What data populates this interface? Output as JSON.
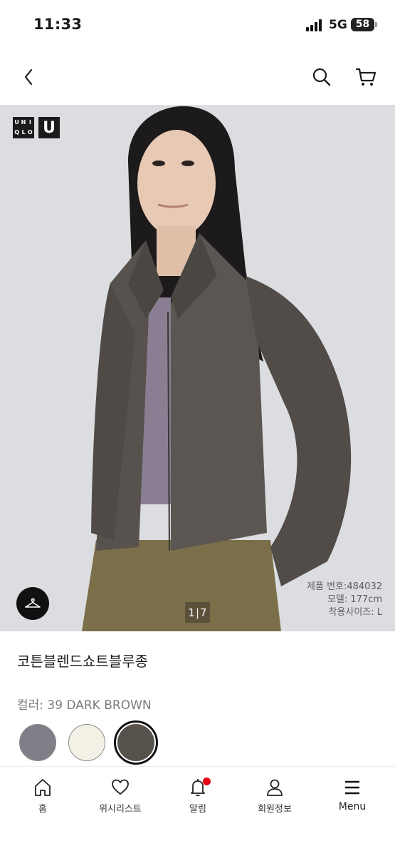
{
  "status_bar": {
    "time": "11:33",
    "network": "5G",
    "battery": "58"
  },
  "nav": {
    "back_icon": "chevron-left-icon",
    "search_icon": "search-icon",
    "cart_icon": "cart-icon"
  },
  "hero": {
    "brand_logo_letters": [
      "U",
      "N",
      "I",
      "Q",
      "L",
      "O"
    ],
    "brand_logo_u": "U",
    "pager": {
      "current": "1",
      "total": "7"
    },
    "model_info": {
      "product_number": "제품 번호:484032",
      "model_height": "모델: 177cm",
      "fit_size": "착용사이즈: L"
    },
    "hanger_icon": "hanger-icon"
  },
  "product": {
    "name": "코튼블렌드쇼트블루종",
    "color_label": "컬러: 39 DARK BROWN",
    "swatches": [
      {
        "color": "#807f87",
        "selected": false
      },
      {
        "color": "#f3f0e6",
        "selected": false
      },
      {
        "color": "#57524c",
        "selected": true
      }
    ]
  },
  "tab_bar": {
    "home": "홈",
    "wishlist": "위시리스트",
    "alerts": "알림",
    "member": "회원정보",
    "menu": "Menu",
    "alerts_badge_color": "#e60012"
  }
}
